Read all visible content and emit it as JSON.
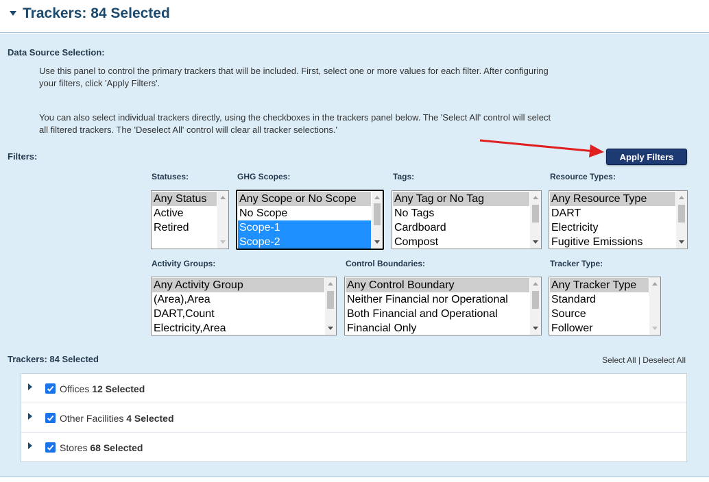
{
  "header": {
    "title": "Trackers: 84 Selected"
  },
  "data_source": {
    "label": "Data Source Selection:",
    "para1_line1": "Use this panel to control the primary trackers that will be included. First, select one or more values for each filter. After configuring",
    "para1_line2": "your filters, click 'Apply Filters'.",
    "para2_line1": "You can also select individual trackers directly, using the checkboxes in the trackers panel below. The 'Select All' control will select",
    "para2_line2": "all filtered trackers. The 'Deselect All' control will clear all tracker selections.'"
  },
  "filters": {
    "label": "Filters:",
    "apply_label": "Apply Filters",
    "statuses": {
      "label": "Statuses:",
      "options": [
        "Any Status",
        "Active",
        "Retired"
      ]
    },
    "ghg_scopes": {
      "label": "GHG Scopes:",
      "options": [
        "Any Scope or No Scope",
        "No Scope",
        "Scope-1",
        "Scope-2"
      ],
      "selected": [
        "Scope-1",
        "Scope-2"
      ]
    },
    "tags": {
      "label": "Tags:",
      "options": [
        "Any Tag or No Tag",
        "No Tags",
        "Cardboard",
        "Compost"
      ]
    },
    "resource_types": {
      "label": "Resource Types:",
      "options": [
        "Any Resource Type",
        "DART",
        "Electricity",
        "Fugitive Emissions"
      ]
    },
    "activity_groups": {
      "label": "Activity Groups:",
      "options": [
        "Any Activity Group",
        "(Area),Area",
        "DART,Count",
        "Electricity,Area"
      ]
    },
    "control_boundaries": {
      "label": "Control Boundaries:",
      "options": [
        "Any Control Boundary",
        "Neither Financial nor Operational",
        "Both Financial and Operational",
        "Financial Only"
      ]
    },
    "tracker_type": {
      "label": "Tracker Type:",
      "options": [
        "Any Tracker Type",
        "Standard",
        "Source",
        "Follower"
      ]
    }
  },
  "trackers": {
    "label": "Trackers: 84 Selected",
    "select_all": "Select All",
    "separator": "|",
    "deselect_all": "Deselect All",
    "groups": [
      {
        "name": "Offices",
        "count": "12 Selected",
        "checked": true
      },
      {
        "name": "Other Facilities",
        "count": "4 Selected",
        "checked": true
      },
      {
        "name": "Stores",
        "count": "68 Selected",
        "checked": true
      }
    ]
  },
  "colors": {
    "panel_bg": "#dcedf7",
    "title": "#1c4a6e",
    "apply_button": "#1e3a72",
    "selected_option": "#1e90ff",
    "checkbox": "#1a73e8",
    "arrow": "#e02020"
  },
  "icons": [
    "collapse-caret-icon",
    "expand-triangle-icon",
    "checkbox-checked-icon",
    "red-arrow-icon"
  ]
}
